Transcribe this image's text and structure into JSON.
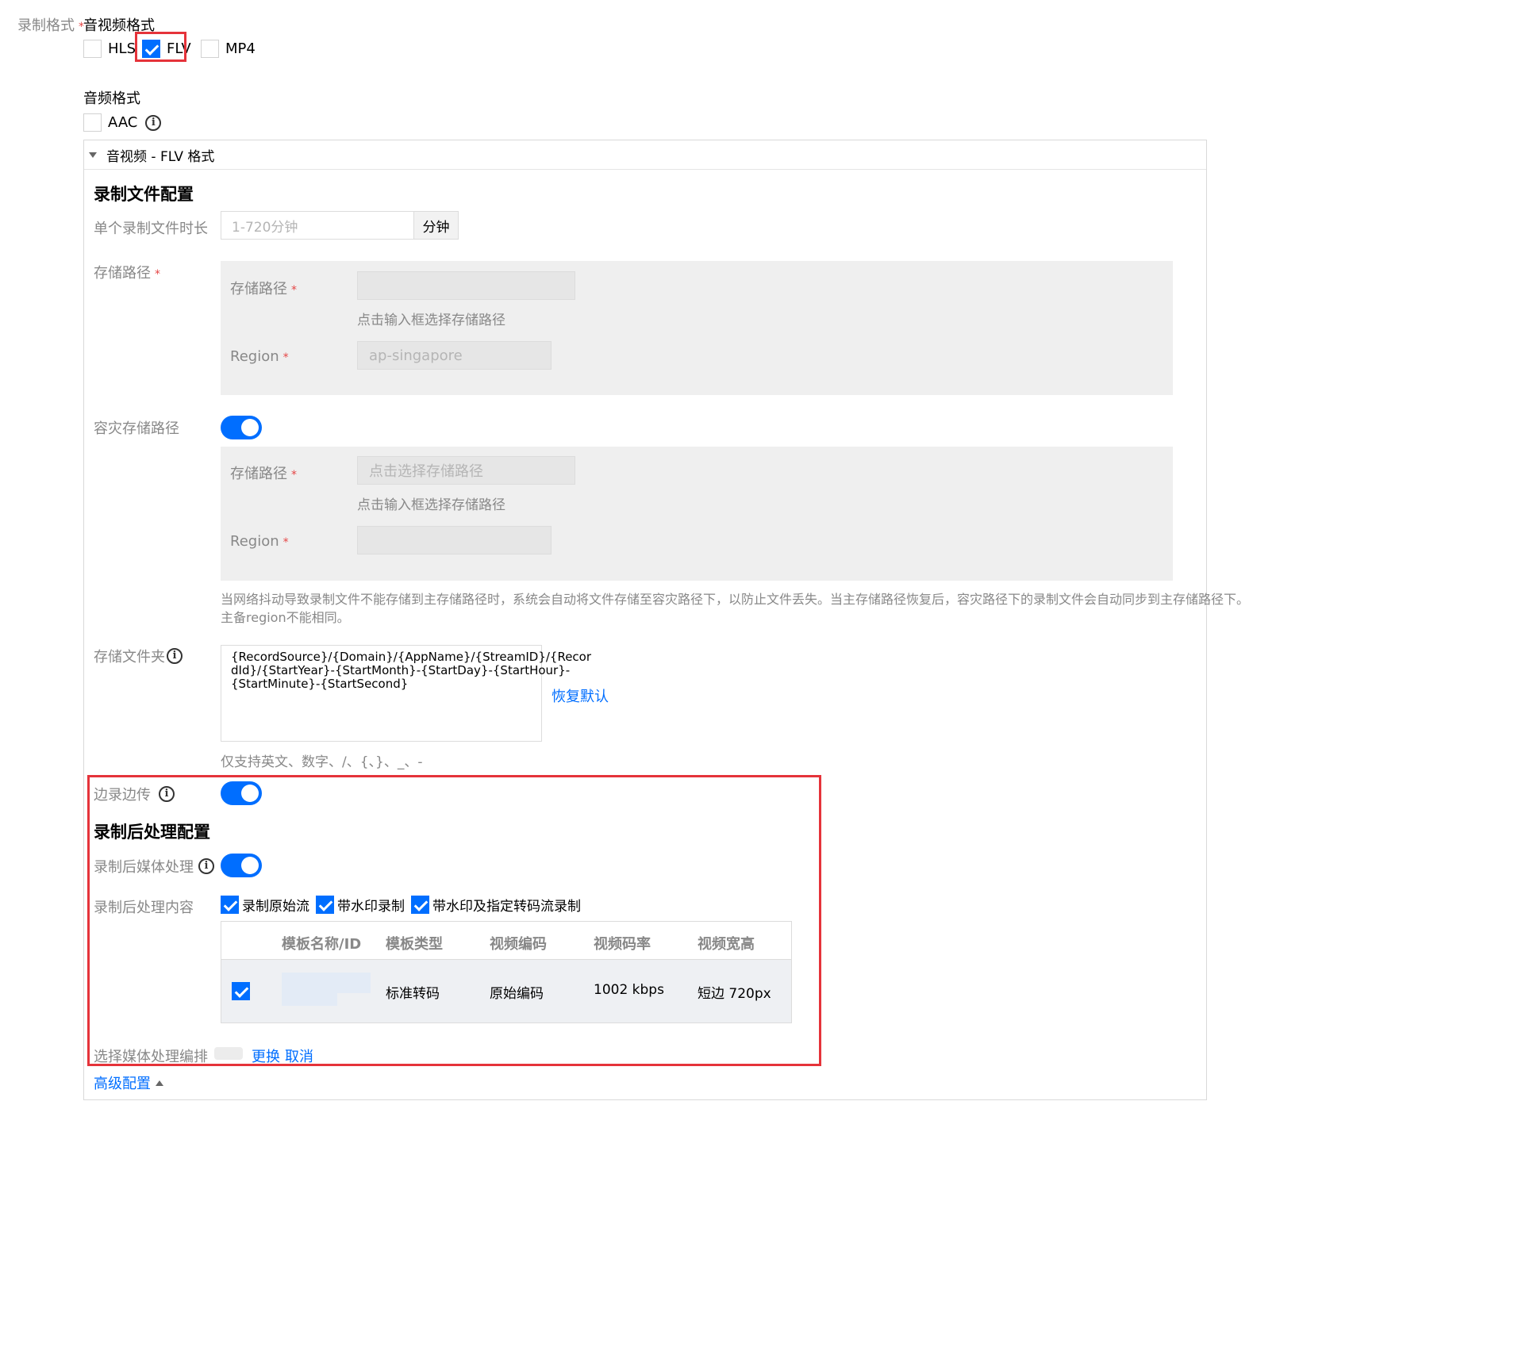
{
  "record_format": {
    "label": "录制格式",
    "required": "*",
    "av_format_title": "音视频格式",
    "av_options": [
      {
        "label": "HLS",
        "checked": false
      },
      {
        "label": "FLV",
        "checked": true
      },
      {
        "label": "MP4",
        "checked": false
      }
    ],
    "audio_format_title": "音频格式",
    "audio_options": [
      {
        "label": "AAC",
        "checked": false
      }
    ]
  },
  "panel": {
    "header": "音视频 - FLV 格式",
    "file_config_title": "录制文件配置",
    "duration": {
      "label": "单个录制文件时长",
      "placeholder": "1-720分钟",
      "unit": "分钟"
    },
    "storage_path": {
      "label": "存储路径",
      "required": "*",
      "inner_label": "存储路径",
      "value": "",
      "hint": "点击输入框选择存储路径",
      "region_label": "Region",
      "region_value": "ap-singapore"
    },
    "backup_storage": {
      "label": "容灾存储路径",
      "enabled": true,
      "inner_label": "存储路径",
      "placeholder": "点击选择存储路径",
      "hint": "点击输入框选择存储路径",
      "region_label": "Region",
      "region_value": "",
      "note_line1": "当网络抖动导致录制文件不能存储到主存储路径时，系统会自动将文件存储至容灾路径下，以防止文件丢失。当主存储路径恢复后，容灾路径下的录制文件会自动同步到主存储路径下。",
      "note_line2": "主备region不能相同。"
    },
    "folder": {
      "label": "存储文件夹",
      "line1": "{RecordSource}/{Domain}/{AppName}/{StreamID}/{Recor",
      "line2": "dId}/{StartYear}-{StartMonth}-{StartDay}-{StartHour}-",
      "line3": "{StartMinute}-{StartSecond}",
      "restore": "恢复默认",
      "hint": "仅支持英文、数字、/、{、}、_、-"
    },
    "edge_record": {
      "label": "边录边传",
      "enabled": true
    },
    "post_title": "录制后处理配置",
    "post_media": {
      "label": "录制后媒体处理",
      "enabled": true
    },
    "post_content": {
      "label": "录制后处理内容",
      "options": [
        {
          "label": "录制原始流",
          "checked": true
        },
        {
          "label": "带水印录制",
          "checked": true
        },
        {
          "label": "带水印及指定转码流录制",
          "checked": true
        }
      ]
    },
    "template_table": {
      "headers": [
        "模板名称/ID",
        "模板类型",
        "视频编码",
        "视频码率",
        "视频宽高"
      ],
      "rows": [
        {
          "checked": true,
          "name": "",
          "type": "标准转码",
          "codec": "原始编码",
          "bitrate": "1002 kbps",
          "size": "短边 720px"
        }
      ]
    },
    "media_arrange": {
      "label": "选择媒体处理编排",
      "replace": "更换",
      "cancel": "取消"
    },
    "advanced": "高级配置"
  }
}
